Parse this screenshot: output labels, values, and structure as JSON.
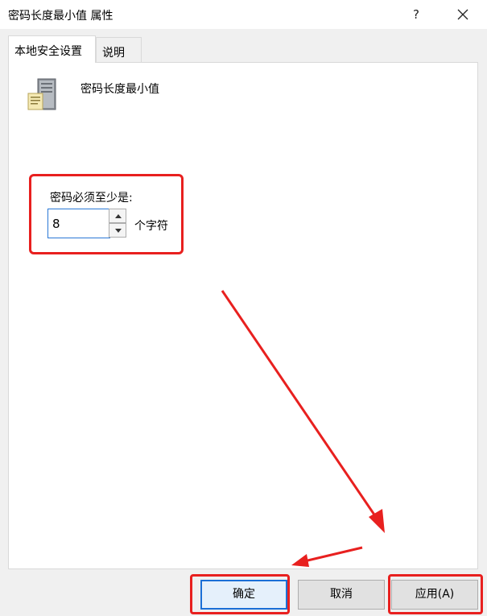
{
  "window": {
    "title": "密码长度最小值 属性",
    "help_label": "?"
  },
  "tabs": [
    {
      "label": "本地安全设置",
      "active": true
    },
    {
      "label": "说明",
      "active": false
    }
  ],
  "policy": {
    "name": "密码长度最小值",
    "icon": "server-policy-icon"
  },
  "setting": {
    "label": "密码必须至少是:",
    "value": "8",
    "unit": "个字符"
  },
  "buttons": {
    "ok": "确定",
    "cancel": "取消",
    "apply": "应用(A)"
  },
  "annotation_color": "#e8201f"
}
